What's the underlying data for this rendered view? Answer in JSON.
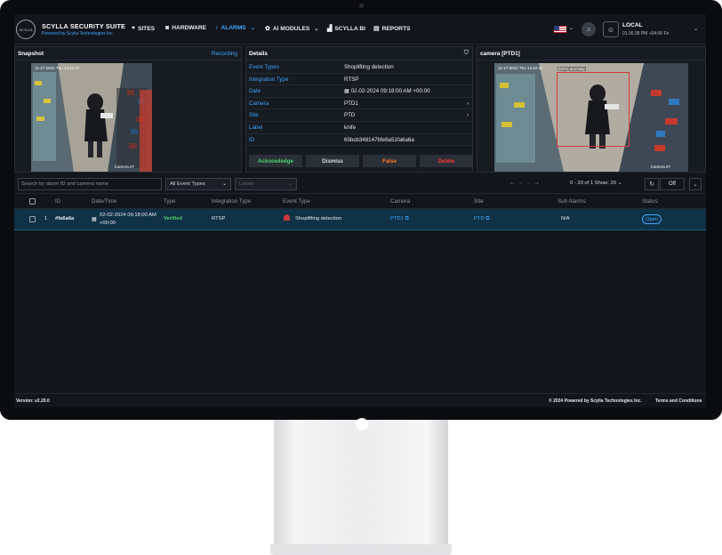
{
  "brand": {
    "logo_text": "SCYLLA",
    "title": "SCYLLA SECURITY SUITE",
    "subtitle": "Powered by Scylla Technologies Inc."
  },
  "nav": [
    {
      "label": "SITES",
      "icon": "pin-icon"
    },
    {
      "label": "HARDWARE",
      "icon": "camera-icon"
    },
    {
      "label": "ALARMS",
      "icon": "bell-icon",
      "active": true
    },
    {
      "label": "AI MODULES",
      "icon": "brain-icon"
    },
    {
      "label": "SCYLLA BI",
      "icon": "bar-chart-icon"
    },
    {
      "label": "REPORTS",
      "icon": "report-icon"
    }
  ],
  "header_right": {
    "location": "LOCAL",
    "time": "01:36:38 PM +04:00 Fri"
  },
  "snapshot": {
    "title": "Snapshot",
    "recording_label": "Recording",
    "timestamp": "11-17-2022 Thu 14:42:47",
    "camera_label": "Camera 07"
  },
  "details": {
    "title": "Details",
    "rows": [
      {
        "key": "Event Types",
        "value": "Shoplifting detection"
      },
      {
        "key": "Integration Type",
        "value": "RTSP"
      },
      {
        "key": "Date",
        "value": "02-02-2024 09:18:00 AM +00:00"
      },
      {
        "key": "Camera",
        "value": "PTD1"
      },
      {
        "key": "Site",
        "value": "PTD"
      },
      {
        "key": "Label",
        "value": "knife"
      },
      {
        "key": "ID",
        "value": "65bcb348147bfe8a51fa6a6a"
      }
    ],
    "actions": [
      {
        "label": "Acknowledge",
        "color": "#4cd36b"
      },
      {
        "label": "Dismiss",
        "color": "#d8dde6"
      },
      {
        "label": "False",
        "color": "#ff7a1a"
      },
      {
        "label": "Delete",
        "color": "#ff3b3b"
      }
    ]
  },
  "camera_panel": {
    "title": "camera [PTD1]",
    "timestamp": "11-17-2022 Thu 14:42:47",
    "box_label": "[62%] anomaly",
    "camera_label": "Camera 07"
  },
  "toolbar": {
    "search_placeholder": "Search by alarm ID and camera name",
    "event_types": "All Event Types",
    "labels": "Labels",
    "page_info": "0 - 20 of 1",
    "show_label": "Show:",
    "show_value": "20",
    "off_label": "Off"
  },
  "table": {
    "headers": [
      "ID",
      "Date/Time",
      "Type",
      "Integration Type",
      "Event Type",
      "Camera",
      "Site",
      "Sub Alarms",
      "Status"
    ],
    "rows": [
      {
        "index": "1",
        "id": "#fa6a6a",
        "date_line1": "02-02-2024 09:18:00 AM",
        "date_line2": "+00:00",
        "type": "Verified",
        "integration": "RTSP",
        "event_type": "Shoplifting detection",
        "camera": "PTD1",
        "site": "PTD",
        "sub_alarms": "N/A",
        "status": "Open"
      }
    ]
  },
  "footer": {
    "version": "Version: v2.20.0",
    "copyright": "© 2024 Powered by Scylla Technologies Inc.",
    "terms": "Terms and Conditions"
  }
}
